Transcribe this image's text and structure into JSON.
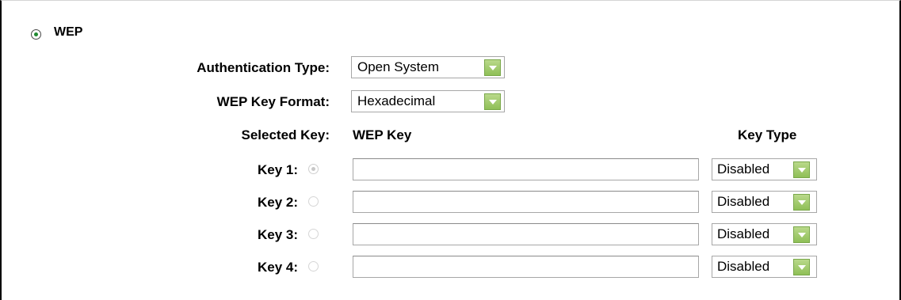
{
  "security": {
    "mode_label": "WEP",
    "auth_type_label": "Authentication Type:",
    "auth_type_value": "Open System",
    "key_format_label": "WEP Key Format:",
    "key_format_value": "Hexadecimal",
    "selected_key_label": "Selected Key:",
    "wep_key_header": "WEP Key",
    "key_type_header": "Key Type",
    "keys": [
      {
        "label": "Key 1:",
        "value": "",
        "type": "Disabled"
      },
      {
        "label": "Key 2:",
        "value": "",
        "type": "Disabled"
      },
      {
        "label": "Key 3:",
        "value": "",
        "type": "Disabled"
      },
      {
        "label": "Key 4:",
        "value": "",
        "type": "Disabled"
      }
    ]
  }
}
